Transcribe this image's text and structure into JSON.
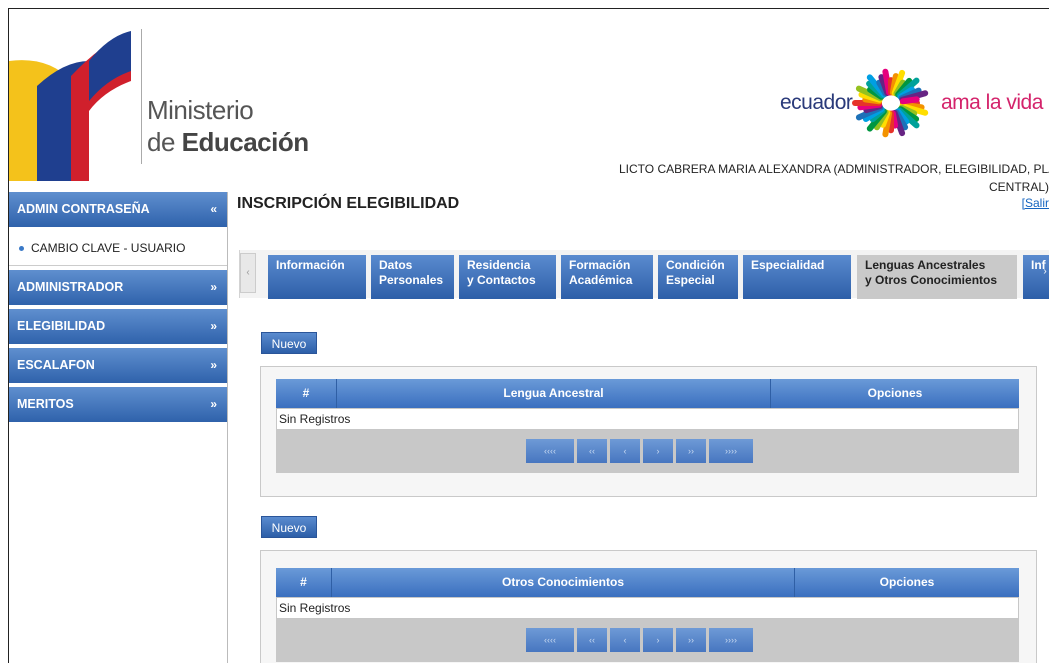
{
  "header": {
    "ministry_line1": "Ministerio",
    "ministry_line2_prefix": "de ",
    "ministry_line2_bold": "Educación",
    "ecuador_word": "ecuador",
    "ama_la_vida": "ama la vida",
    "user_line1": "LICTO CABRERA MARIA ALEXANDRA (ADMINISTRADOR, ELEGIBILIDAD, PLANTA",
    "user_line2": "CENTRAL)",
    "salir": "[Salir"
  },
  "sidebar": {
    "sections": [
      {
        "label": "ADMIN CONTRASEÑA",
        "chev": "«",
        "sub": [
          "CAMBIO CLAVE - USUARIO"
        ]
      },
      {
        "label": "ADMINISTRADOR",
        "chev": "»"
      },
      {
        "label": "ELEGIBILIDAD",
        "chev": "»"
      },
      {
        "label": "ESCALAFON",
        "chev": "»"
      },
      {
        "label": "MERITOS",
        "chev": "»"
      }
    ]
  },
  "main": {
    "title": "INSCRIPCIÓN ELEGIBILIDAD",
    "tab_scroll_left": "‹",
    "tab_scroll_right": "›",
    "tabs": [
      {
        "l1": "Información",
        "l2": ""
      },
      {
        "l1": "Datos",
        "l2": "Personales"
      },
      {
        "l1": "Residencia",
        "l2": "y Contactos"
      },
      {
        "l1": "Formación",
        "l2": "Académica"
      },
      {
        "l1": "Condición",
        "l2": "Especial"
      },
      {
        "l1": "Especialidad",
        "l2": ""
      },
      {
        "l1": "Lenguas Ancestrales",
        "l2": "y Otros Conocimientos"
      },
      {
        "l1": "",
        "l2": "Inf"
      }
    ],
    "active_tab": 6,
    "nuevo_label": "Nuevo",
    "grid1": {
      "columns": [
        "#",
        "Lengua Ancestral",
        "Opciones"
      ],
      "empty": "Sin Registros"
    },
    "grid2": {
      "columns": [
        "#",
        "Otros Conocimientos",
        "Opciones"
      ],
      "empty": "Sin Registros"
    },
    "pager": [
      "‹‹‹‹",
      "‹‹",
      "‹",
      "›",
      "››",
      "››››"
    ]
  },
  "colors": {
    "accent": "#2f62ab",
    "active_tab": "#c9c9c9"
  }
}
